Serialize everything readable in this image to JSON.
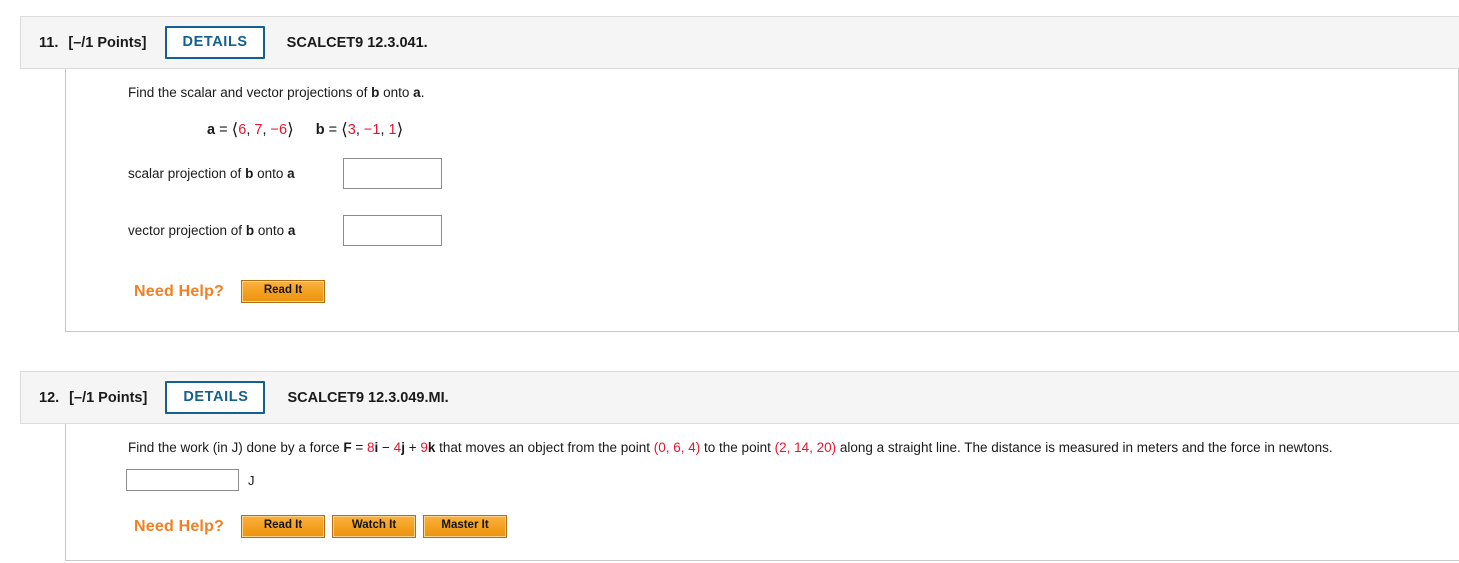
{
  "questions": [
    {
      "number": "11.",
      "points": "[–/1 Points]",
      "details_label": "DETAILS",
      "code": "SCALCET9 12.3.041.",
      "prompt_pre": "Find the scalar and vector projections of ",
      "prompt_b": "b",
      "prompt_mid": " onto ",
      "prompt_a": "a",
      "prompt_end": ".",
      "vector_a": {
        "name": "a",
        "eq": " = ",
        "open": "⟨",
        "c1": "6",
        "sep1": ", ",
        "c2": "7",
        "sep2": ", ",
        "c3": "−6",
        "close": "⟩"
      },
      "vector_b": {
        "name": "b",
        "eq": " = ",
        "open": "⟨",
        "c1": "3",
        "sep1": ", ",
        "c2": "−1",
        "sep2": ", ",
        "c3": "1",
        "close": "⟩"
      },
      "fields": [
        {
          "label_pre": "scalar projection of ",
          "label_b": "b",
          "label_mid": " onto ",
          "label_a": "a",
          "value": ""
        },
        {
          "label_pre": "vector projection of ",
          "label_b": "b",
          "label_mid": " onto ",
          "label_a": "a",
          "value": ""
        }
      ],
      "need_help_label": "Need Help?",
      "help_buttons": [
        "Read It"
      ]
    },
    {
      "number": "12.",
      "points": "[–/1 Points]",
      "details_label": "DETAILS",
      "code": "SCALCET9 12.3.049.MI.",
      "text": {
        "s1": "Find the work (in J) done by a force ",
        "force_symbol": "F",
        "s2": " = ",
        "f1": "8",
        "i": "i",
        "op1": " − ",
        "f2": "4",
        "j": "j",
        "op2": " + ",
        "f3": "9",
        "k": "k",
        "s3": " that moves an object from the point ",
        "p1": "(0, 6, 4)",
        "s4": " to the point ",
        "p2": "(2, 14, 20)",
        "s5": " along a straight line. The distance is measured in meters and the force in newtons."
      },
      "answer_value": "",
      "unit": "J",
      "need_help_label": "Need Help?",
      "help_buttons": [
        "Read It",
        "Watch It",
        "Master It"
      ]
    }
  ],
  "colors": {
    "accent_blue": "#14618f",
    "value_red": "#e8142d",
    "need_help_orange": "#f08021",
    "button_orange": "#f3a01f",
    "header_bg": "#f5f5f5"
  }
}
